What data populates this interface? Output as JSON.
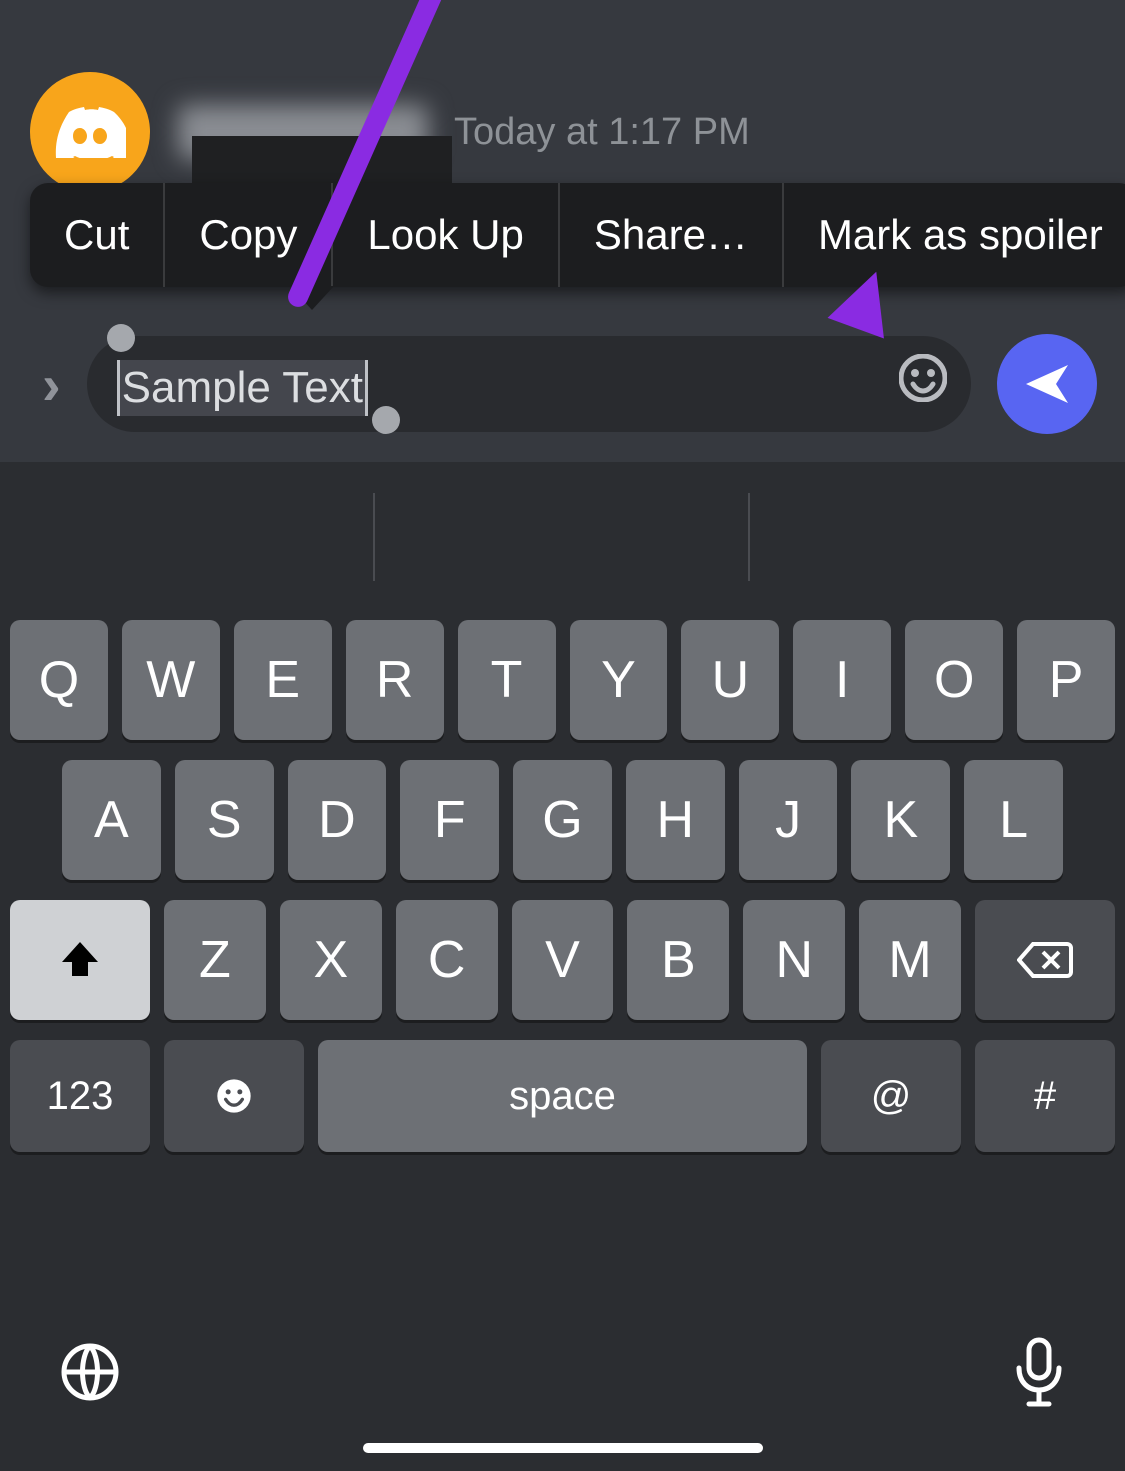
{
  "message": {
    "timestamp": "Today at 1:17 PM"
  },
  "context_menu": {
    "items": [
      "Cut",
      "Copy",
      "Look Up",
      "Share…",
      "Mark as spoiler"
    ]
  },
  "input": {
    "expand_icon": "expand",
    "selected_text": "Sample Text",
    "emoji_icon": "emoji",
    "send_icon": "send"
  },
  "keyboard": {
    "row1": [
      "Q",
      "W",
      "E",
      "R",
      "T",
      "Y",
      "U",
      "I",
      "O",
      "P"
    ],
    "row2": [
      "A",
      "S",
      "D",
      "F",
      "G",
      "H",
      "J",
      "K",
      "L"
    ],
    "row3": [
      "Z",
      "X",
      "C",
      "V",
      "B",
      "N",
      "M"
    ],
    "shift_icon": "shift",
    "backspace_icon": "backspace",
    "numbers_label": "123",
    "emoji_key_icon": "emoji",
    "space_label": "space",
    "at_label": "@",
    "hash_label": "#",
    "globe_icon": "globe",
    "mic_icon": "mic"
  },
  "annotation": {
    "arrow_target": "Mark as spoiler"
  }
}
